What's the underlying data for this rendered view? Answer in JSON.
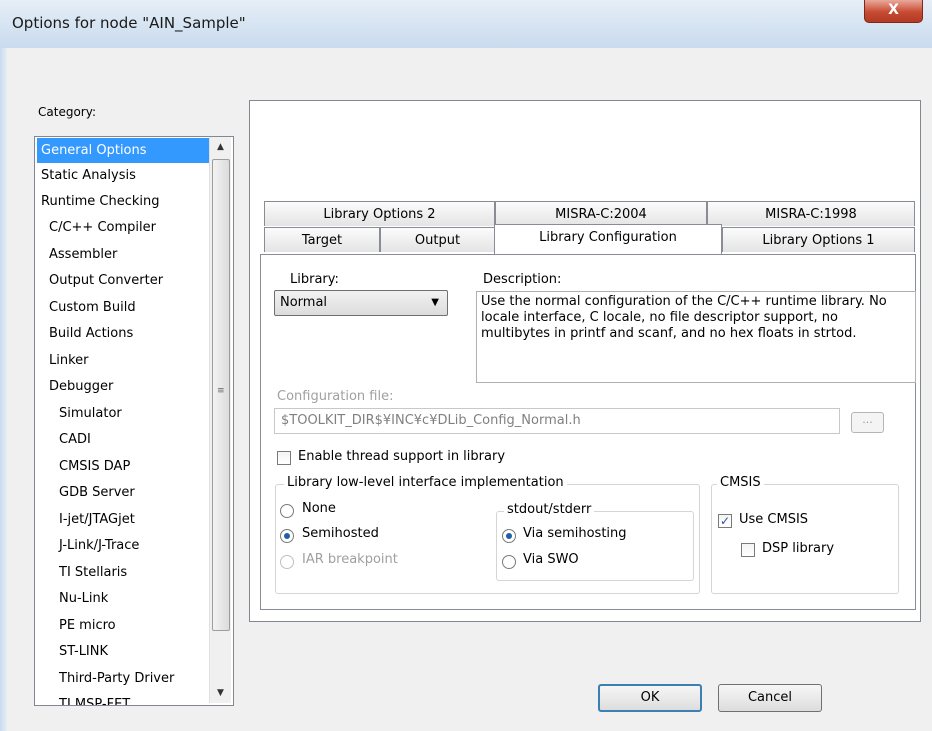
{
  "window": {
    "title": "Options for node \"AIN_Sample\"",
    "close_glyph": "X"
  },
  "category": {
    "label": "Category:",
    "items": [
      "General Options",
      "Static Analysis",
      "Runtime Checking",
      "C/C++ Compiler",
      "Assembler",
      "Output Converter",
      "Custom Build",
      "Build Actions",
      "Linker",
      "Debugger",
      "Simulator",
      "CADI",
      "CMSIS DAP",
      "GDB Server",
      "I-jet/JTAGjet",
      "J-Link/J-Trace",
      "TI Stellaris",
      "Nu-Link",
      "PE micro",
      "ST-LINK",
      "Third-Party Driver",
      "TI MSP-FET"
    ],
    "selected": "General Options"
  },
  "tabs": {
    "row1": [
      "Library Options 2",
      "MISRA-C:2004",
      "MISRA-C:1998"
    ],
    "row2": [
      "Target",
      "Output",
      "Library Configuration",
      "Library Options 1"
    ],
    "active": "Library Configuration"
  },
  "library": {
    "label": "Library:",
    "value": "Normal"
  },
  "description": {
    "label": "Description:",
    "text": "Use the normal configuration of the C/C++ runtime library. No locale interface, C locale, no file descriptor support, no multibytes in printf and scanf, and no hex floats in strtod."
  },
  "config_file": {
    "label": "Configuration file:",
    "value": "$TOOLKIT_DIR$¥INC¥c¥DLib_Config_Normal.h",
    "browse": "..."
  },
  "thread_support": {
    "label": "Enable thread support in library",
    "checked": false
  },
  "low_level": {
    "title": "Library low-level interface implementation",
    "options": [
      "None",
      "Semihosted",
      "IAR breakpoint"
    ],
    "selected": "Semihosted"
  },
  "stdout": {
    "title": "stdout/stderr",
    "options": [
      "Via semihosting",
      "Via SWO"
    ],
    "selected": "Via semihosting"
  },
  "cmsis": {
    "title": "CMSIS",
    "use_cmsis": "Use CMSIS",
    "use_checked": true,
    "dsp": "DSP library",
    "dsp_checked": false
  },
  "buttons": {
    "ok": "OK",
    "cancel": "Cancel"
  },
  "icons": {
    "check_glyph": "✓",
    "dropdown_arrow": "▼",
    "scroll_up": "▲",
    "scroll_down": "▼",
    "grip": "≡"
  }
}
